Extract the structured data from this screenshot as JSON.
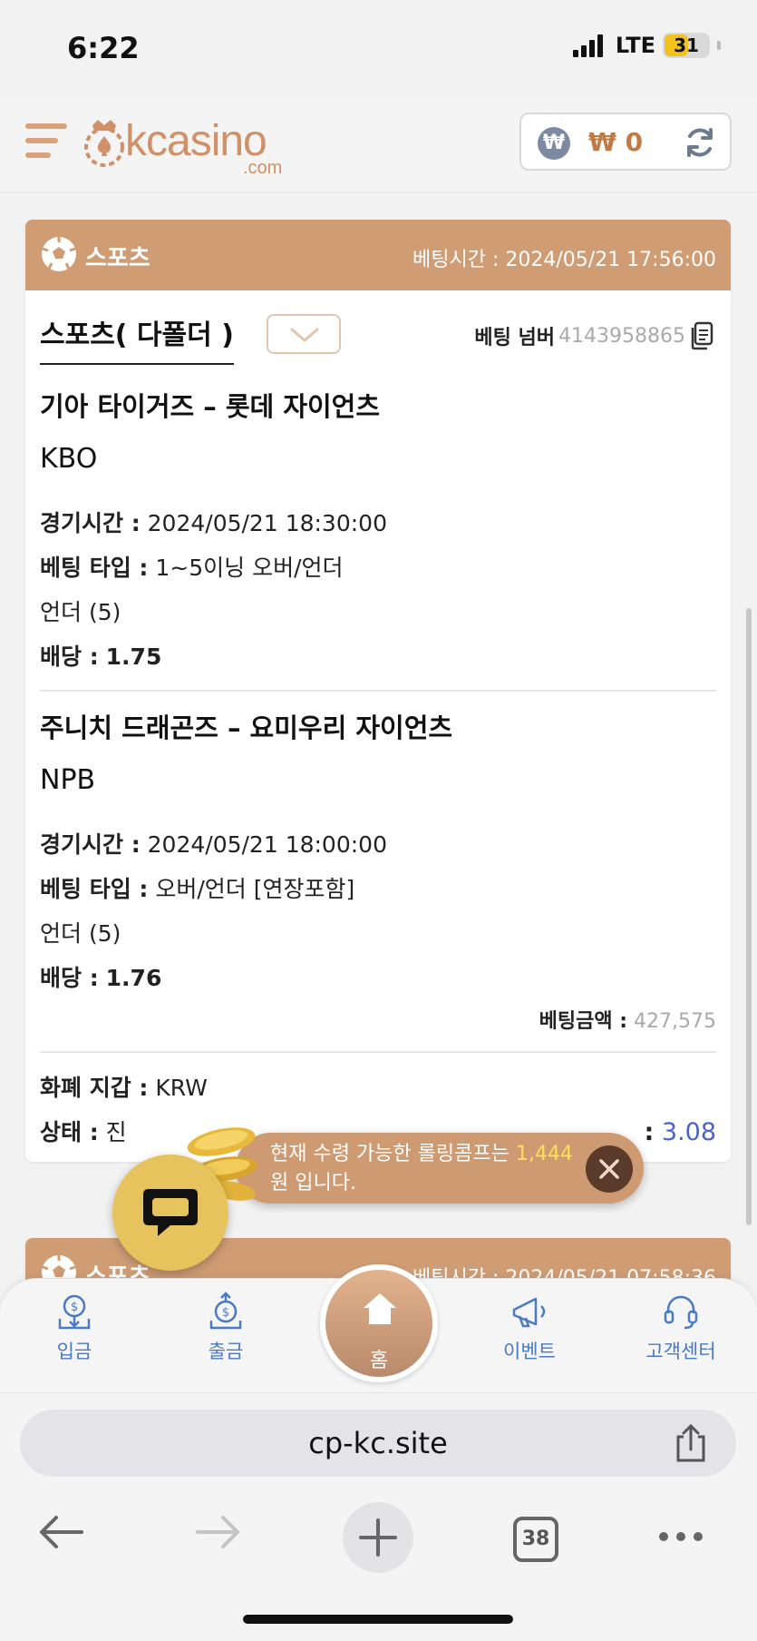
{
  "status_bar": {
    "time": "6:22",
    "network": "LTE",
    "battery": "31"
  },
  "header": {
    "logo_text": "kcasino",
    "logo_sub": ".com",
    "currency_symbol": "₩",
    "balance": "₩ 0"
  },
  "cards": [
    {
      "category": "스포츠",
      "bet_time_label": "베팅시간 :",
      "bet_time": "2024/05/21 17:56:00",
      "bet_type": "스포츠( 다폴더 )",
      "bet_number_label": "베팅 넘버",
      "bet_number": "4143958865",
      "matches": [
        {
          "title": "기아 타이거즈 – 롯데 자이언츠",
          "league": "KBO",
          "game_time_label": "경기시간 :",
          "game_time": "2024/05/21 18:30:00",
          "bet_kind_label": "베팅 타입 :",
          "bet_kind": "1~5이닝 오버/언더",
          "pick": "언더 (5)",
          "odds_label": "배당 :",
          "odds": "1.75"
        },
        {
          "title": "주니치 드래곤즈 – 요미우리 자이언츠",
          "league": "NPB",
          "game_time_label": "경기시간 :",
          "game_time": "2024/05/21 18:00:00",
          "bet_kind_label": "베팅 타입 :",
          "bet_kind": "오버/언더 [연장포함]",
          "pick": "언더 (5)",
          "odds_label": "배당 :",
          "odds": "1.76"
        }
      ],
      "bet_amount_label": "베팅금액 :",
      "bet_amount": "427,575",
      "wallet_label": "화폐 지갑 :",
      "wallet_value": "KRW",
      "status_label": "상태 :",
      "status_value": "진",
      "total_odds_suffix": ":",
      "total_odds": "3.08"
    },
    {
      "category": "스포츠",
      "bet_time_label": "베팅시간 :",
      "bet_time": "2024/05/21 07:58:36"
    }
  ],
  "toast": {
    "text_before": "현재 수령 가능한 롤링콤프는 ",
    "amount": "1,444",
    "text_after": "원 입니다."
  },
  "bottom_nav": {
    "deposit": "입금",
    "withdraw": "출금",
    "home": "홈",
    "event": "이벤트",
    "support": "고객센터"
  },
  "browser": {
    "url": "cp-kc.site",
    "tab_count": "38"
  },
  "colors": {
    "accent": "#cf9c74",
    "link_blue": "#4a79c5",
    "odds_blue": "#4b63c8"
  }
}
